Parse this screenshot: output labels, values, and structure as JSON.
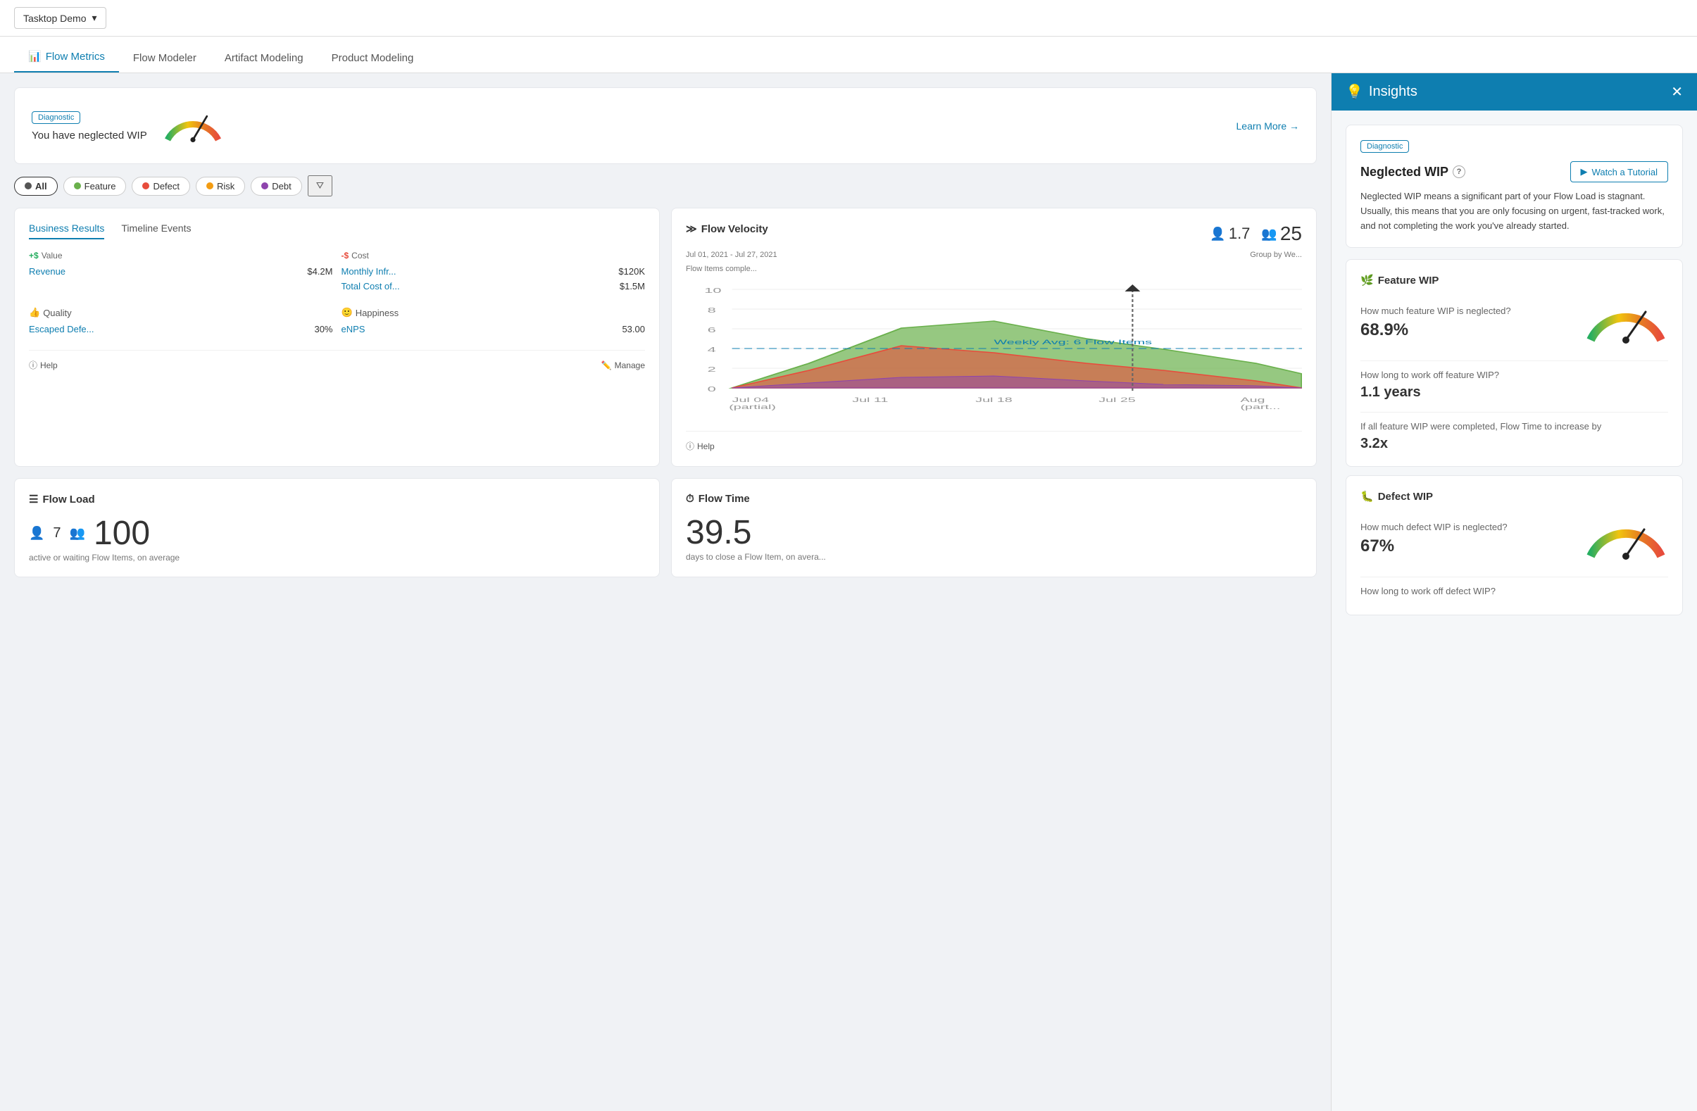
{
  "topBar": {
    "workspace": "Tasktop Demo",
    "chevron": "▾"
  },
  "navTabs": [
    {
      "id": "flow-metrics",
      "label": "Flow Metrics",
      "active": true,
      "icon": "📊"
    },
    {
      "id": "flow-modeler",
      "label": "Flow Modeler",
      "active": false
    },
    {
      "id": "artifact-modeling",
      "label": "Artifact Modeling",
      "active": false
    },
    {
      "id": "product-modeling",
      "label": "Product Modeling",
      "active": false
    }
  ],
  "diagnosticCard": {
    "badge": "Diagnostic",
    "text": "You have neglected WIP",
    "learnMore": "Learn More →"
  },
  "filters": [
    {
      "id": "all",
      "label": "All",
      "active": true,
      "color": "all"
    },
    {
      "id": "feature",
      "label": "Feature",
      "active": false,
      "color": "feature"
    },
    {
      "id": "defect",
      "label": "Defect",
      "active": false,
      "color": "defect"
    },
    {
      "id": "risk",
      "label": "Risk",
      "active": false,
      "color": "risk"
    },
    {
      "id": "debt",
      "label": "Debt",
      "active": false,
      "color": "debt"
    }
  ],
  "businessResults": {
    "title": "Business Results",
    "tabs": [
      "Business Results",
      "Timeline Events"
    ],
    "value": {
      "header": "+$ Value",
      "items": [
        {
          "label": "Revenue",
          "value": "$4.2M"
        }
      ]
    },
    "cost": {
      "header": "-$ Cost",
      "items": [
        {
          "label": "Monthly Infr...",
          "value": "$120K"
        },
        {
          "label": "Total Cost of...",
          "value": "$1.5M"
        }
      ]
    },
    "quality": {
      "header": "Quality",
      "items": [
        {
          "label": "Escaped Defe...",
          "value": "30%"
        }
      ]
    },
    "happiness": {
      "header": "Happiness",
      "items": [
        {
          "label": "eNPS",
          "value": "53.00"
        }
      ]
    },
    "helpLink": "Help",
    "manageLink": "Manage"
  },
  "flowVelocity": {
    "title": "Flow Velocity",
    "personIcon1": "👤",
    "value1": "1.7",
    "personIcon2": "👥",
    "value2": "25",
    "dateRange": "Jul 01, 2021 - Jul 27, 2021",
    "groupBy": "Group by We...",
    "subtitle": "Flow Items comple...",
    "helpLink": "Help"
  },
  "flowLoad": {
    "title": "Flow Load",
    "personIcon": "👤",
    "value1": "7",
    "groupIcon": "👥",
    "value2": "100",
    "subtitle": "active or waiting Flow Items, on average"
  },
  "flowTime": {
    "title": "Flow Time",
    "value": "39.5",
    "subtitle": "days to close a Flow Item, on avera..."
  },
  "insights": {
    "title": "Insights",
    "badge": "Diagnostic",
    "mainTitle": "Neglected WIP",
    "questionMark": "?",
    "watchTutorial": "Watch a Tutorial",
    "description": "Neglected WIP means a significant part of your Flow Load is stagnant. Usually, this means that you are only focusing on urgent, fast-tracked work, and not completing the work you've already started.",
    "featureWip": {
      "title": "Feature WIP",
      "icon": "🌿",
      "q1": "How much feature WIP is neglected?",
      "v1": "68.9",
      "v1unit": "%",
      "q2": "How long to work off feature WIP?",
      "v2": "1.1 years",
      "q3": "If all feature WIP were completed, Flow Time to increase by",
      "v3": "3.2",
      "v3unit": "x"
    },
    "defectWip": {
      "title": "Defect WIP",
      "icon": "🐛",
      "q1": "How much defect WIP is neglected?",
      "v1": "67",
      "v1unit": "%",
      "q2": "How long to work off defect WIP?"
    }
  }
}
